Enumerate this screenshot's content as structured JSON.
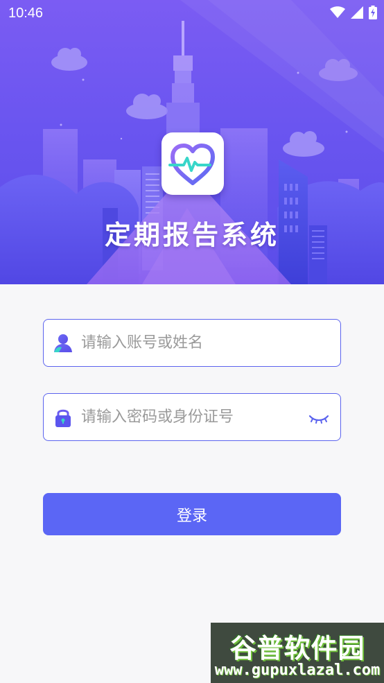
{
  "status_bar": {
    "time": "10:46",
    "icons": [
      "wifi-icon",
      "signal-icon",
      "battery-charging-icon"
    ]
  },
  "header": {
    "app_title": "定期报告系统",
    "logo_icon": "heart-pulse-icon"
  },
  "form": {
    "account": {
      "placeholder": "请输入账号或姓名",
      "value": "",
      "icon": "user-icon"
    },
    "password": {
      "placeholder": "请输入密码或身份证号",
      "value": "",
      "icon": "lock-icon",
      "toggle_icon": "eye-closed-icon"
    },
    "login_label": "登录"
  },
  "watermark": {
    "title": "谷普软件园",
    "url": "www.gupuxlazal.com"
  },
  "colors": {
    "accent": "#5b66f5",
    "field_border": "#5b63ee",
    "hero_top": "#7b5cf3",
    "hero_bottom": "#5a4de8",
    "logo_gradient_start": "#8a6cf5",
    "logo_gradient_end": "#38d6c9"
  }
}
